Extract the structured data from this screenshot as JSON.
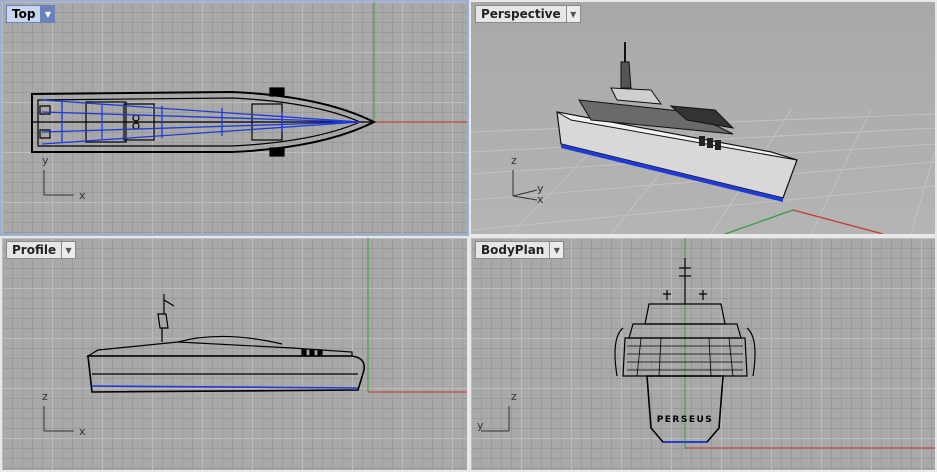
{
  "viewports": [
    {
      "id": "top",
      "title": "Top",
      "active": true
    },
    {
      "id": "perspective",
      "title": "Perspective",
      "active": false
    },
    {
      "id": "profile",
      "title": "Profile",
      "active": false
    },
    {
      "id": "bodyplan",
      "title": "BodyPlan",
      "active": false
    }
  ],
  "dropdown_glyph": "▼",
  "axes": {
    "top": {
      "v": "y",
      "h": "x"
    },
    "perspective": {
      "v": "z",
      "h": "y",
      "h2": "x"
    },
    "profile": {
      "v": "z",
      "h": "x"
    },
    "bodyplan": {
      "v": "z",
      "h": "y"
    }
  },
  "model": {
    "hull_name": "PERSEUS"
  },
  "colors": {
    "x_axis": "#c0392b",
    "y_axis": "#2e9e3c",
    "curve": "#1f3bd6",
    "line": "#000000",
    "active_title": "#c9d6f0"
  }
}
